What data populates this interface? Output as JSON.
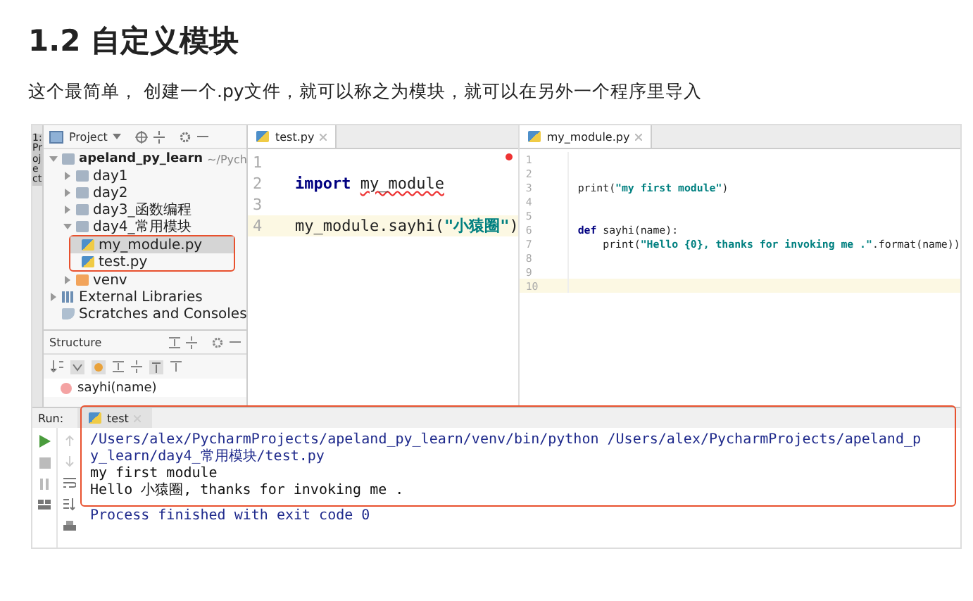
{
  "heading": "1.2 自定义模块",
  "intro": "这个最简单， 创建一个.py文件，就可以称之为模块，就可以在另外一个程序里导入",
  "ide": {
    "side_tool": "1: Project",
    "project": {
      "title": "Project",
      "tree": [
        {
          "label": "apeland_py_learn",
          "hint": "~/Pych",
          "kind": "project",
          "expanded": true,
          "selected": false,
          "children": [
            {
              "label": "day1",
              "kind": "folder",
              "expanded": false,
              "selected": false
            },
            {
              "label": "day2",
              "kind": "folder",
              "expanded": false,
              "selected": false
            },
            {
              "label": "day3_函数编程",
              "kind": "folder",
              "expanded": false,
              "selected": false
            },
            {
              "label": "day4_常用模块",
              "kind": "folder",
              "expanded": true,
              "selected": false,
              "framed": true,
              "children": [
                {
                  "label": "my_module.py",
                  "kind": "python-file",
                  "selected": true
                },
                {
                  "label": "test.py",
                  "kind": "python-file",
                  "selected": false
                }
              ]
            },
            {
              "label": "venv",
              "kind": "excluded-folder",
              "expanded": false,
              "selected": false
            }
          ]
        },
        {
          "label": "External Libraries",
          "kind": "library",
          "expanded": false,
          "selected": false
        },
        {
          "label": "Scratches and Consoles",
          "kind": "scratches",
          "selected": false
        }
      ]
    },
    "structure": {
      "title": "Structure",
      "items": [
        {
          "label": "sayhi(name)",
          "kind": "function"
        }
      ]
    },
    "editors": [
      {
        "tab": "test.py",
        "error_mark": true,
        "lines": [
          {
            "number": "1",
            "current": false
          },
          {
            "number": "2",
            "current": false,
            "tokens": [
              {
                "kind": "keyword",
                "text": "import"
              },
              {
                "kind": "unresolved",
                "text": "my_module"
              }
            ]
          },
          {
            "number": "3",
            "current": false
          },
          {
            "number": "4",
            "current": true,
            "tokens": [
              {
                "kind": "plain",
                "text": "my_module.sayhi("
              },
              {
                "kind": "string",
                "text": "\"小猿圈\""
              },
              {
                "kind": "plain",
                "text": ")"
              }
            ]
          }
        ]
      },
      {
        "tab": "my_module.py",
        "error_mark": false,
        "lines": [
          {
            "number": "1",
            "current": false
          },
          {
            "number": "2",
            "current": false
          },
          {
            "number": "3",
            "current": false,
            "tokens": [
              {
                "kind": "plain",
                "text": "print("
              },
              {
                "kind": "string",
                "text": "\"my first module\""
              },
              {
                "kind": "plain",
                "text": ")"
              }
            ]
          },
          {
            "number": "4",
            "current": false
          },
          {
            "number": "5",
            "current": false
          },
          {
            "number": "6",
            "current": false,
            "tokens": [
              {
                "kind": "keyword",
                "text": "def"
              },
              {
                "kind": "plain",
                "text": "sayhi(name):"
              }
            ]
          },
          {
            "number": "7",
            "current": false,
            "tokens": [
              {
                "kind": "plain",
                "text": "    print("
              },
              {
                "kind": "string",
                "text": "\"Hello {0}, thanks for invoking me .\""
              },
              {
                "kind": "plain",
                "text": ".format(name))"
              }
            ]
          },
          {
            "number": "8",
            "current": false
          },
          {
            "number": "9",
            "current": false
          },
          {
            "number": "10",
            "current": true
          }
        ]
      }
    ],
    "run": {
      "label": "Run:",
      "tab": "test",
      "framed": true,
      "lines": [
        {
          "kind": "command",
          "text": "/Users/alex/PycharmProjects/apeland_py_learn/venv/bin/python /Users/alex/PycharmProjects/apeland_py_learn/day4_常用模块/test.py"
        },
        {
          "kind": "output",
          "text": "my first module"
        },
        {
          "kind": "output",
          "text": "Hello 小猿圈, thanks for invoking me ."
        },
        {
          "kind": "status",
          "text": "Process finished with exit code 0"
        }
      ]
    }
  }
}
